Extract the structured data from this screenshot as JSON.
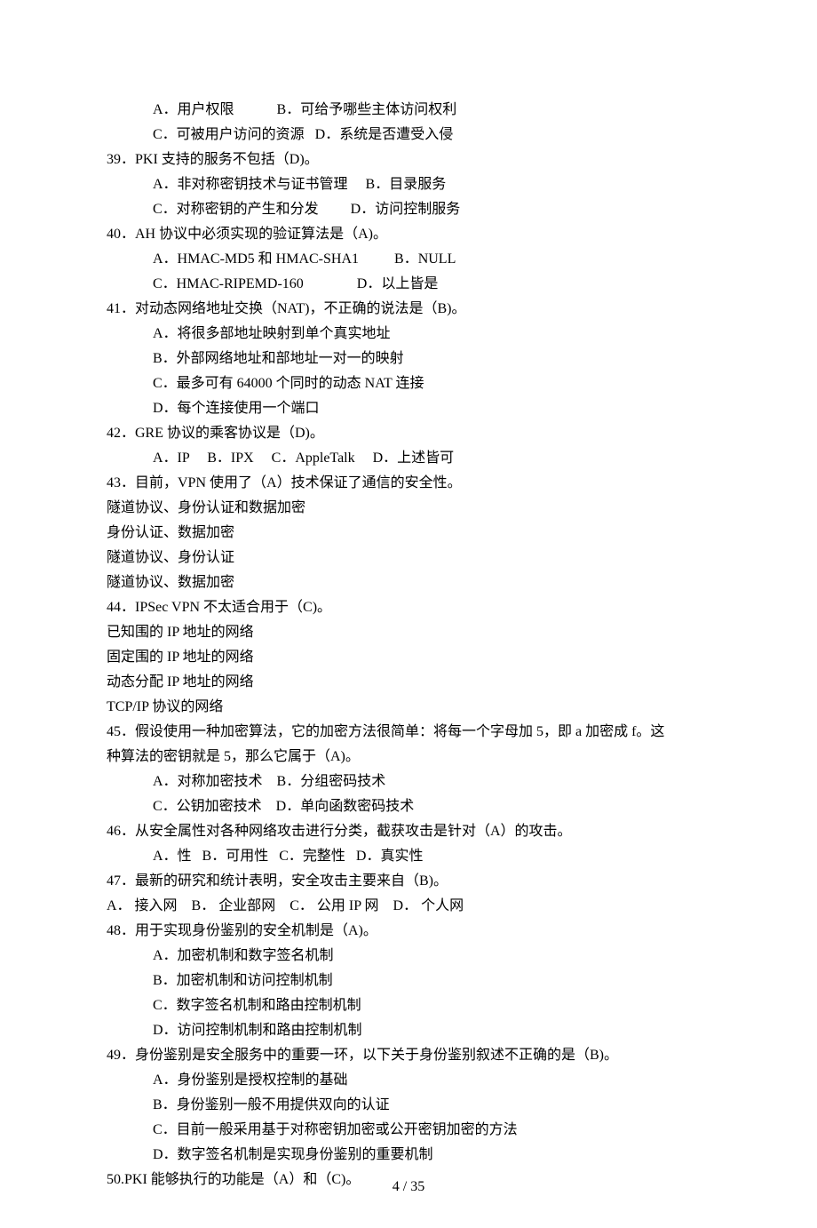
{
  "lines": [
    {
      "cls": "indent1",
      "t": "A．用户权限            B．可给予哪些主体访问权利"
    },
    {
      "cls": "indent1",
      "t": "C．可被用户访问的资源   D．系统是否遭受入侵"
    },
    {
      "cls": "q",
      "t": "39．PKI 支持的服务不包括（D)。"
    },
    {
      "cls": "indent1",
      "t": "A．非对称密钥技术与证书管理     B．目录服务"
    },
    {
      "cls": "indent1",
      "t": "C．对称密钥的产生和分发         D．访问控制服务"
    },
    {
      "cls": "q",
      "t": "40．AH 协议中必须实现的验证算法是（A)。"
    },
    {
      "cls": "indent1",
      "t": "A．HMAC-MD5 和 HMAC-SHA1          B．NULL"
    },
    {
      "cls": "indent1",
      "t": "C．HMAC-RIPEMD-160               D．以上皆是"
    },
    {
      "cls": "q",
      "t": "41．对动态网络地址交换（NAT)，不正确的说法是（B)。"
    },
    {
      "cls": "indent1",
      "t": "A．将很多部地址映射到单个真实地址"
    },
    {
      "cls": "indent1",
      "t": "B．外部网络地址和部地址一对一的映射"
    },
    {
      "cls": "indent1",
      "t": "C．最多可有 64000 个同时的动态 NAT 连接"
    },
    {
      "cls": "indent1",
      "t": "D．每个连接使用一个端口"
    },
    {
      "cls": "q",
      "t": "42．GRE 协议的乘客协议是（D)。"
    },
    {
      "cls": "indent1",
      "t": "A．IP     B．IPX     C．AppleTalk     D．上述皆可"
    },
    {
      "cls": "q",
      "t": "43．目前，VPN 使用了（A）技术保证了通信的安全性。"
    },
    {
      "cls": "q",
      "t": "隧道协议、身份认证和数据加密"
    },
    {
      "cls": "q",
      "t": "身份认证、数据加密"
    },
    {
      "cls": "q",
      "t": "隧道协议、身份认证"
    },
    {
      "cls": "q",
      "t": "隧道协议、数据加密"
    },
    {
      "cls": "q",
      "t": "44．IPSec VPN 不太适合用于（C)。"
    },
    {
      "cls": "q",
      "t": "已知围的 IP 地址的网络"
    },
    {
      "cls": "q",
      "t": "固定围的 IP 地址的网络"
    },
    {
      "cls": "q",
      "t": "动态分配 IP 地址的网络"
    },
    {
      "cls": "q",
      "t": "TCP/IP 协议的网络"
    },
    {
      "cls": "q",
      "t": "45．假设使用一种加密算法，它的加密方法很简单：将每一个字母加 5，即 a 加密成 f。这"
    },
    {
      "cls": "q",
      "t": "种算法的密钥就是 5，那么它属于（A)。"
    },
    {
      "cls": "indent1",
      "t": "A．对称加密技术    B．分组密码技术"
    },
    {
      "cls": "indent1",
      "t": "C．公钥加密技术    D．单向函数密码技术"
    },
    {
      "cls": "q",
      "t": "46．从安全属性对各种网络攻击进行分类，截获攻击是针对（A）的攻击。"
    },
    {
      "cls": "indent1",
      "t": "A．性   B．可用性   C．完整性   D．真实性"
    },
    {
      "cls": "q",
      "t": "47．最新的研究和统计表明，安全攻击主要来自（B)。"
    },
    {
      "cls": "q",
      "t": "A． 接入网    B． 企业部网    C． 公用 IP 网    D． 个人网"
    },
    {
      "cls": "q",
      "t": "48．用于实现身份鉴别的安全机制是（A)。"
    },
    {
      "cls": "indent1",
      "t": "A．加密机制和数字签名机制"
    },
    {
      "cls": "indent1",
      "t": "B．加密机制和访问控制机制"
    },
    {
      "cls": "indent1",
      "t": "C．数字签名机制和路由控制机制"
    },
    {
      "cls": "indent1",
      "t": "D．访问控制机制和路由控制机制"
    },
    {
      "cls": "q",
      "t": "49．身份鉴别是安全服务中的重要一环，以下关于身份鉴别叙述不正确的是（B)。"
    },
    {
      "cls": "indent1",
      "t": "A．身份鉴别是授权控制的基础"
    },
    {
      "cls": "indent1",
      "t": "B．身份鉴别一般不用提供双向的认证"
    },
    {
      "cls": "indent1",
      "t": "C．目前一般采用基于对称密钥加密或公开密钥加密的方法"
    },
    {
      "cls": "indent1",
      "t": "D．数字签名机制是实现身份鉴别的重要机制"
    },
    {
      "cls": "q",
      "t": "50.PKI 能够执行的功能是（A）和（C)。"
    }
  ],
  "footer": "4 / 35"
}
